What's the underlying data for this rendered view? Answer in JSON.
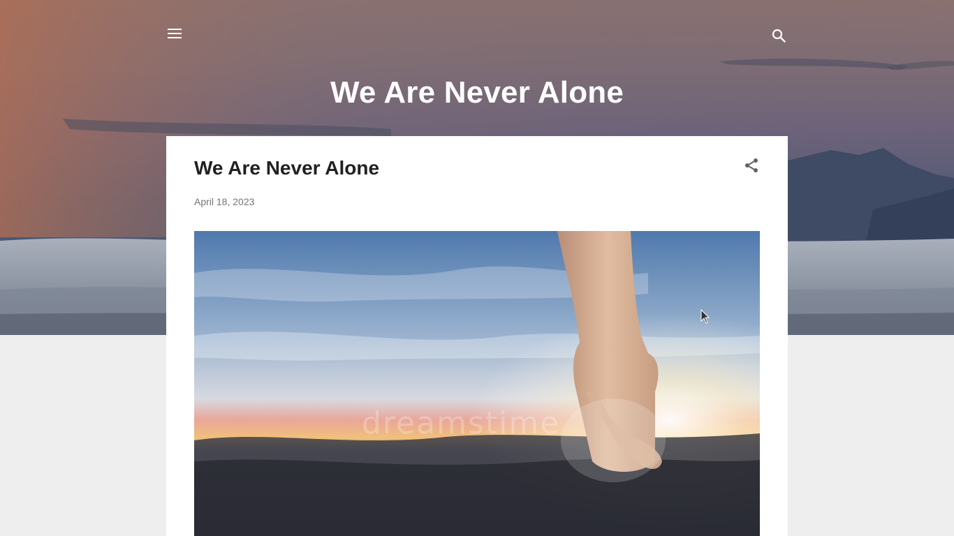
{
  "header": {
    "blog_title": "We Are Never Alone",
    "menu_icon": "hamburger-menu-icon",
    "search_icon": "search-icon"
  },
  "post": {
    "title": "We Are Never Alone",
    "date": "April 18, 2023",
    "share_icon": "share-icon",
    "image": {
      "description_icon": "hands-holding-image",
      "watermark": "dreamstime"
    }
  },
  "colors": {
    "page_bg": "#eeeeee",
    "card_bg": "#ffffff",
    "title_text": "#212121",
    "date_text": "#757575",
    "header_text": "#ffffff"
  }
}
